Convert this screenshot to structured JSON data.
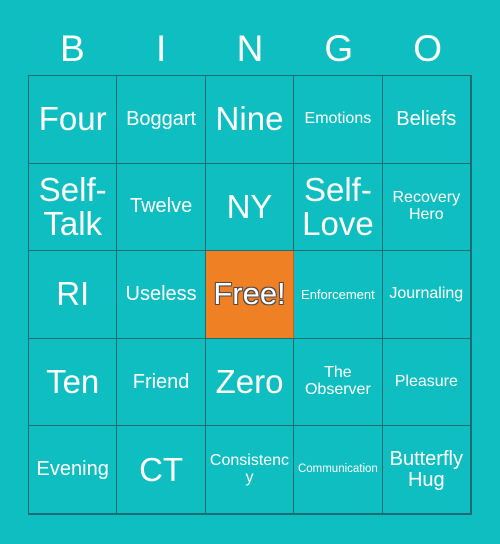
{
  "card": {
    "title": "BINGO Card",
    "background_color": "#0fbec0",
    "border_color": "#1d6b73",
    "text_color": "#ffffff",
    "free_space_color": "#f08024"
  },
  "header": {
    "letters": [
      "B",
      "I",
      "N",
      "G",
      "O"
    ]
  },
  "grid": {
    "rows": 5,
    "columns": 5,
    "cells": [
      [
        {
          "label": "Four",
          "size": "xl",
          "free": false
        },
        {
          "label": "Boggart",
          "size": "md",
          "free": false
        },
        {
          "label": "Nine",
          "size": "xl",
          "free": false
        },
        {
          "label": "Emotions",
          "size": "sm",
          "free": false
        },
        {
          "label": "Beliefs",
          "size": "md",
          "free": false
        }
      ],
      [
        {
          "label": "Self-Talk",
          "size": "xl",
          "free": false
        },
        {
          "label": "Twelve",
          "size": "md",
          "free": false
        },
        {
          "label": "NY",
          "size": "xl",
          "free": false
        },
        {
          "label": "Self-Love",
          "size": "xl",
          "free": false
        },
        {
          "label": "Recovery Hero",
          "size": "sm",
          "free": false
        }
      ],
      [
        {
          "label": "RI",
          "size": "xl",
          "free": false
        },
        {
          "label": "Useless",
          "size": "md",
          "free": false
        },
        {
          "label": "Free!",
          "size": "xl",
          "free": true
        },
        {
          "label": "Enforcement",
          "size": "xs",
          "free": false
        },
        {
          "label": "Journaling",
          "size": "sm",
          "free": false
        }
      ],
      [
        {
          "label": "Ten",
          "size": "xl",
          "free": false
        },
        {
          "label": "Friend",
          "size": "md",
          "free": false
        },
        {
          "label": "Zero",
          "size": "xl",
          "free": false
        },
        {
          "label": "The Observer",
          "size": "sm",
          "free": false
        },
        {
          "label": "Pleasure",
          "size": "sm",
          "free": false
        }
      ],
      [
        {
          "label": "Evening",
          "size": "md",
          "free": false
        },
        {
          "label": "CT",
          "size": "xl",
          "free": false
        },
        {
          "label": "Consistency",
          "size": "sm",
          "free": false
        },
        {
          "label": "Communication",
          "size": "xxs",
          "free": false
        },
        {
          "label": "Butterfly Hug",
          "size": "md",
          "free": false
        }
      ]
    ]
  }
}
